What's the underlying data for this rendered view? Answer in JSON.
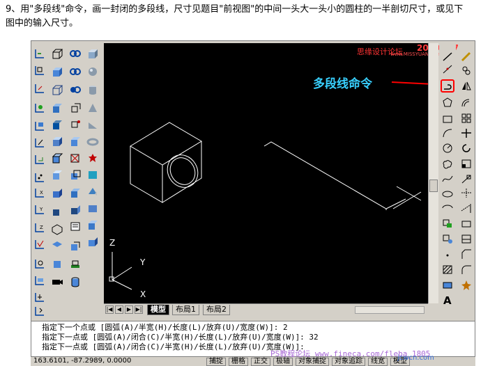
{
  "instruction": {
    "line1": "9、用\"多段线\"命令，画一封闭的多段线，尺寸见题目\"前视图\"的中间一头大一头小的圆柱的一半剖切尺寸，或见下",
    "line2": "图中的输入尺寸。"
  },
  "annotation": {
    "label": "多段线命令",
    "color": "#38d0ff",
    "arrow_color": "#ff0000"
  },
  "watermarks": {
    "site_cn": "思缘设计论坛",
    "date": "2009-9-7",
    "site_url": "www.MISSYUAN.com",
    "bottom_site": "PS教程论坛 www.fineca.com/fleba_1805",
    "bottom_brand": "jcwcn.com"
  },
  "ucs": {
    "z": "Z",
    "y": "Y",
    "x": "X"
  },
  "layout_tabs": [
    {
      "label": "模型",
      "active": true
    },
    {
      "label": "布局1",
      "active": false
    },
    {
      "label": "布局2",
      "active": false
    }
  ],
  "command_lines": [
    "指定下一个点或 [圆弧(A)/半宽(H)/长度(L)/放弃(U)/宽度(W)]: 2",
    "指定下一点或 [圆弧(A)/闭合(C)/半宽(H)/长度(L)/放弃(U)/宽度(W)]: 32",
    "指定下一点或 [圆弧(A)/闭合(C)/半宽(H)/长度(L)/放弃(U)/宽度(W)]:"
  ],
  "status": {
    "coords": "163.6101, -87.2989, 0.0000",
    "buttons": [
      "捕捉",
      "栅格",
      "正交",
      "极轴",
      "对象捕捉",
      "对象追踪",
      "线宽",
      "模型"
    ]
  },
  "right_toolbar_letter": "A",
  "colors": {
    "canvas": "#000000",
    "chrome": "#d4d0c8",
    "highlight": "#ff0000"
  }
}
